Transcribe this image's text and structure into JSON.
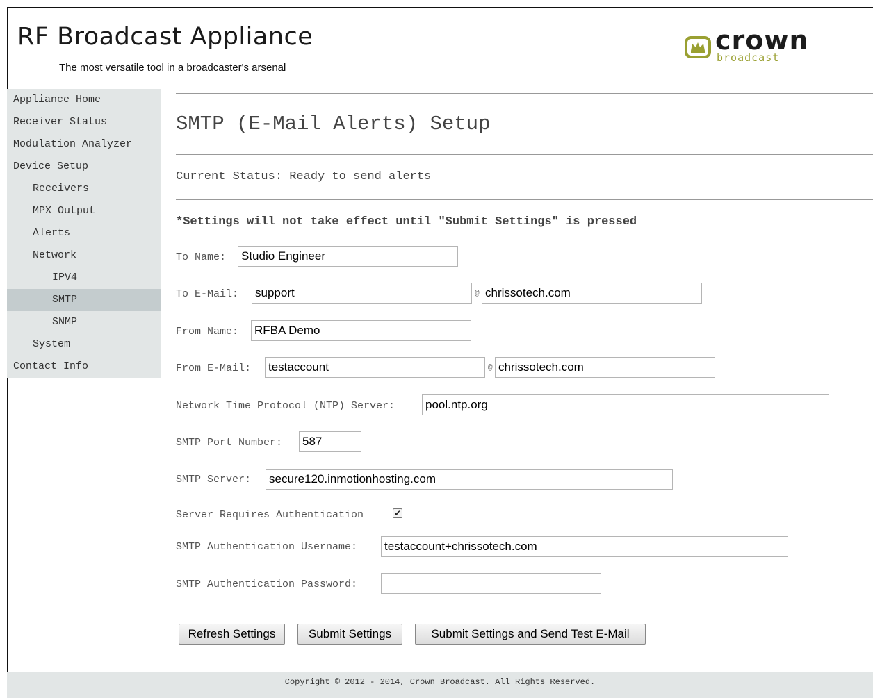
{
  "header": {
    "title": "RF Broadcast Appliance",
    "tagline": "The most versatile tool in a broadcaster's arsenal",
    "logo_word1": "crown",
    "logo_word2": "broadcast",
    "logo_icon": "crown-icon",
    "brand_color": "#9aa032"
  },
  "sidebar": {
    "items": [
      {
        "label": "Appliance Home"
      },
      {
        "label": "Receiver Status"
      },
      {
        "label": "Modulation Analyzer"
      },
      {
        "label": "Device Setup"
      },
      {
        "label": "Receivers"
      },
      {
        "label": "MPX Output"
      },
      {
        "label": "Alerts"
      },
      {
        "label": "Network"
      },
      {
        "label": "IPV4"
      },
      {
        "label": "SMTP"
      },
      {
        "label": "SNMP"
      },
      {
        "label": "System"
      },
      {
        "label": "Contact Info"
      }
    ],
    "active": "SMTP"
  },
  "page": {
    "title": "SMTP (E-Mail Alerts) Setup",
    "status": "Current Status: Ready to send alerts",
    "note": "*Settings will not take effect until \"Submit Settings\" is pressed"
  },
  "form": {
    "to_name_label": "To Name:",
    "to_name_value": "Studio Engineer",
    "to_email_label": "To E-Mail:",
    "to_email_user": "support",
    "to_email_domain": "chrissotech.com",
    "at_sign": "@",
    "from_name_label": "From Name:",
    "from_name_value": "RFBA Demo",
    "from_email_label": "From E-Mail:",
    "from_email_user": "testaccount",
    "from_email_domain": "chrissotech.com",
    "ntp_label": "Network Time Protocol (NTP) Server:",
    "ntp_value": "pool.ntp.org",
    "port_label": "SMTP Port Number:",
    "port_value": "587",
    "server_label": "SMTP Server:",
    "server_value": "secure120.inmotionhosting.com",
    "auth_label": "Server Requires Authentication",
    "auth_checked": true,
    "auth_check_glyph": "✔",
    "username_label": "SMTP Authentication Username:",
    "username_value": "testaccount+chrissotech.com",
    "password_label": "SMTP Authentication Password:",
    "password_value": ""
  },
  "buttons": {
    "refresh": "Refresh Settings",
    "submit": "Submit Settings",
    "submit_test": "Submit Settings and Send Test E-Mail"
  },
  "footer": {
    "copyright": "Copyright © 2012 - 2014, Crown Broadcast. All Rights Reserved."
  }
}
